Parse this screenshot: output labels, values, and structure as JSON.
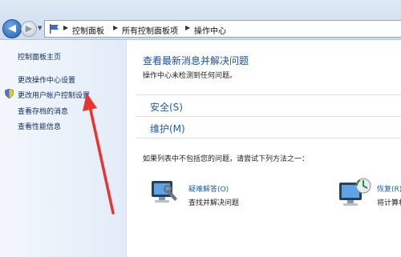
{
  "breadcrumb": {
    "items": [
      "控制面板",
      "所有控制面板项",
      "操作中心"
    ]
  },
  "sidebar": {
    "home": "控制面板主页",
    "items": [
      {
        "label": "更改操作中心设置"
      },
      {
        "label": "更改用户帐户控制设置"
      },
      {
        "label": "查看存档的消息"
      },
      {
        "label": "查看性能信息"
      }
    ]
  },
  "main": {
    "title": "查看最新消息并解决问题",
    "subtitle": "操作中心未检测到任何问题。",
    "sections": [
      {
        "label": "安全(S)"
      },
      {
        "label": "维护(M)"
      }
    ],
    "hint": "如果列表中不包括您的问题，请尝试下列方法之一：",
    "tools": [
      {
        "link": "疑难解答(O)",
        "desc": "查找并解决问题"
      },
      {
        "link": "恢复(R)",
        "desc": "将计算机"
      }
    ]
  },
  "colors": {
    "accent": "#1b5ea8",
    "annotation_arrow": "#e8352f"
  }
}
